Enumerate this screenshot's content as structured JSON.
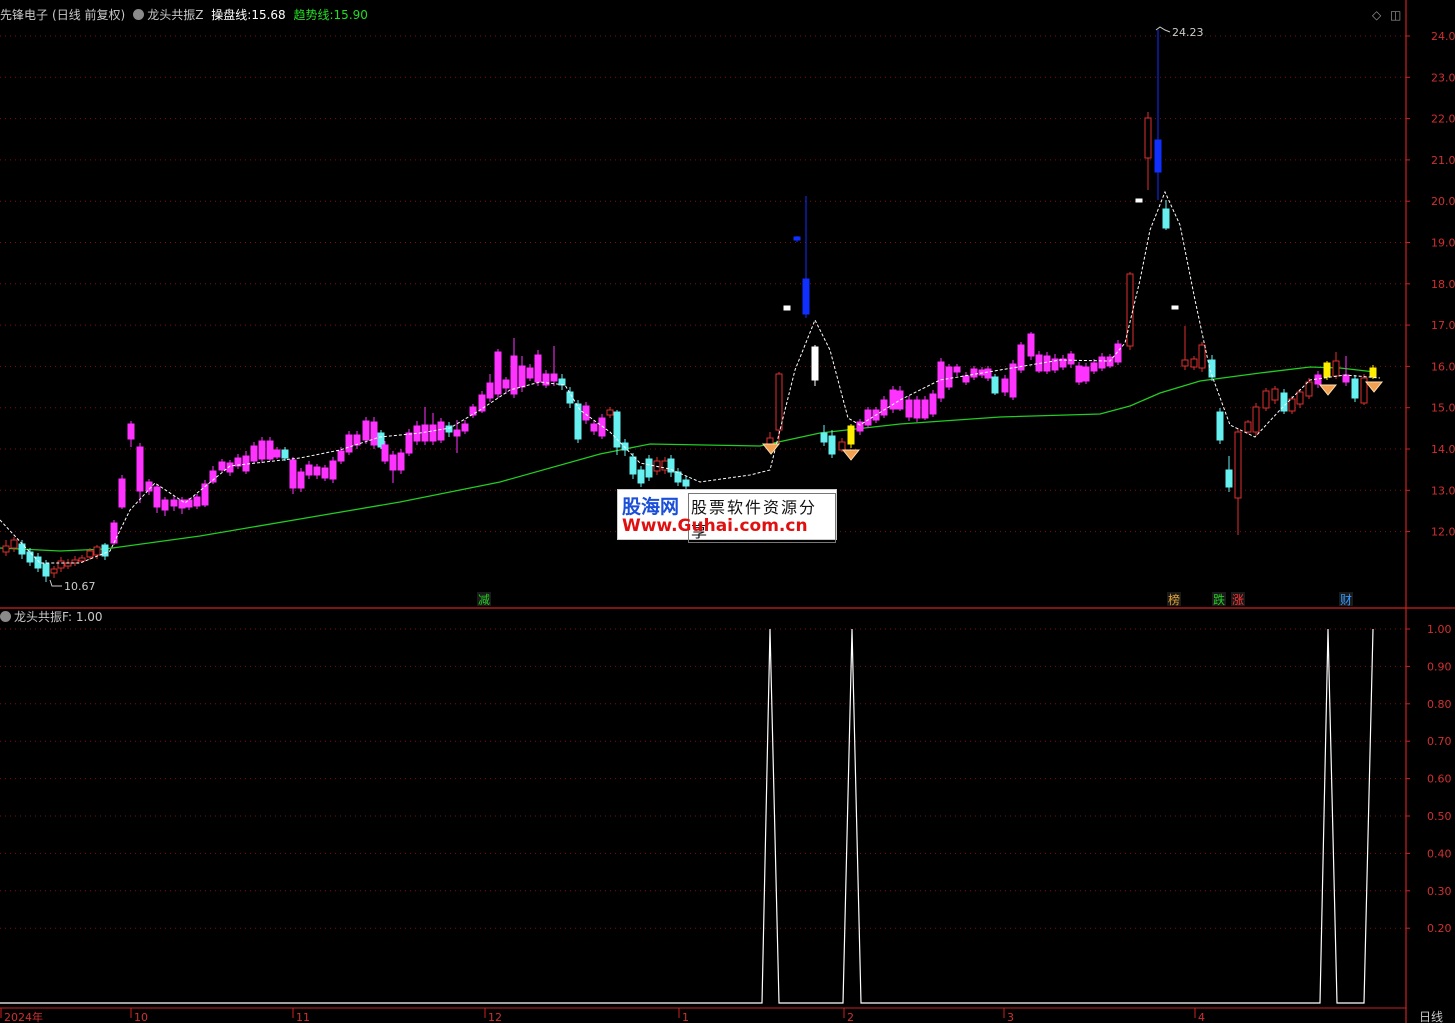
{
  "header": {
    "stock_name": "先锋电子",
    "period": "(日线 前复权)",
    "indicator_name": "龙头共振Z",
    "op_line_label": "操盘线:",
    "op_line_value": "15.68",
    "trend_line_label": "趋势线:",
    "trend_line_value": "15.90"
  },
  "controls": {
    "diamond": "◇",
    "window": "◫"
  },
  "sub_header": {
    "indicator_name": "龙头共振F",
    "value_text": ": 1.00"
  },
  "markers": {
    "m1": "减",
    "m2": "榜",
    "m3": "跌",
    "m4": "涨",
    "m5": "财"
  },
  "price_notes": {
    "high": "24.23",
    "low": "10.67"
  },
  "period_label": "日线",
  "watermark": {
    "logo": "股海网",
    "tagline": "股票软件资源分享",
    "url": "Www.Guhai.com.cn"
  },
  "colors": {
    "background": "#000000",
    "up_candle": "#ff33ff",
    "down_candle": "#66f0f0",
    "trend_line": "#22cc22",
    "op_line": "#ffffff",
    "grid": "#7a1010",
    "axis": "#cc2222",
    "signal": "#ffffff"
  },
  "chart_data": [
    {
      "type": "candlestick",
      "y_ticks": [
        "24.00",
        "23.00",
        "22.00",
        "21.00",
        "20.00",
        "19.00",
        "18.00",
        "17.00",
        "16.00",
        "15.00",
        "14.00",
        "13.00",
        "12.00"
      ],
      "ylim": [
        10.4,
        24.8
      ],
      "x_labels": [
        "2024年",
        "10",
        "11",
        "12",
        "1",
        "2",
        "3",
        "4"
      ],
      "high": 24.23,
      "low": 10.67,
      "series": [
        {
          "name": "操盘线",
          "values": [
            15.68
          ]
        },
        {
          "name": "趋势线",
          "values": [
            15.9
          ]
        }
      ]
    },
    {
      "type": "line",
      "y_ticks": [
        "1.00",
        "0.90",
        "0.80",
        "0.70",
        "0.60",
        "0.50",
        "0.40",
        "0.30",
        "0.20"
      ],
      "ylim": [
        0,
        1
      ],
      "series": [
        {
          "name": "龙头共振F",
          "values": [
            0,
            0,
            0,
            0,
            1,
            0,
            1,
            0,
            0,
            0,
            1,
            1,
            0
          ]
        }
      ]
    }
  ]
}
